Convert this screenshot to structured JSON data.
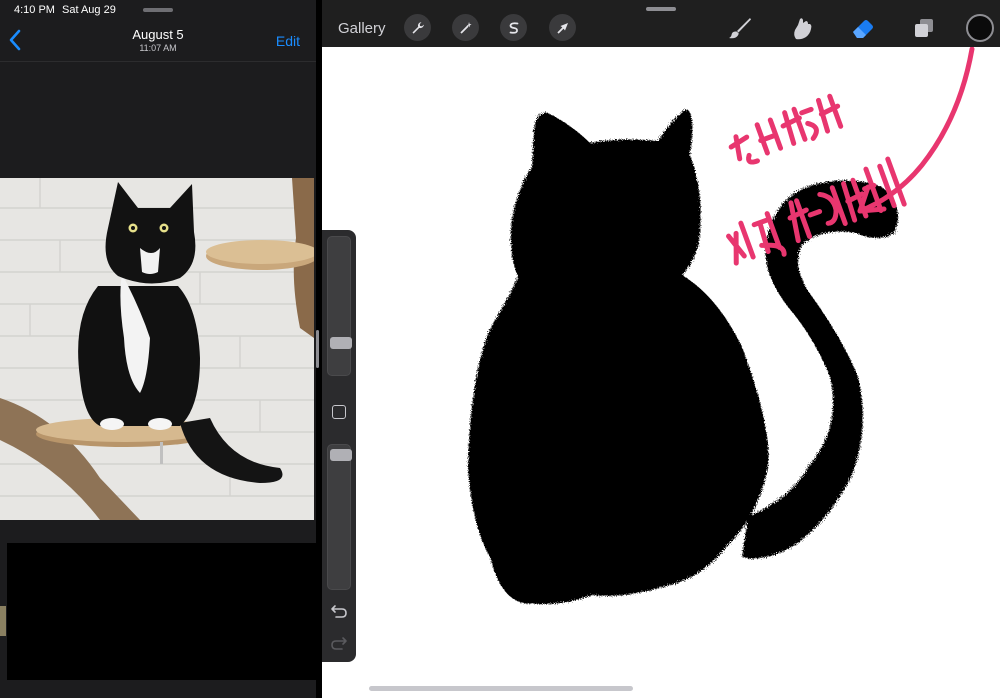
{
  "status_bar": {
    "time": "4:10 PM",
    "date": "Sat Aug 29"
  },
  "photos": {
    "nav": {
      "back_icon": "chevron-left-icon",
      "title": "August 5",
      "subtitle": "11:07 AM",
      "edit_label": "Edit"
    },
    "photo_subject": "cat-photo"
  },
  "procreate": {
    "gallery_label": "Gallery",
    "left_tools": [
      "wrench-icon",
      "magic-wand-icon",
      "selection-icon",
      "transform-arrow-icon"
    ],
    "right_tools": [
      "brush-icon",
      "smudge-icon",
      "eraser-icon",
      "layers-icon"
    ],
    "active_tool": "eraser",
    "current_color": "#0b0b0b",
    "accent_color": "#1a7cf2",
    "annotation_color": "#e8366f",
    "annotation_text": [
      "실물",
      "세상 해치운다"
    ],
    "sidebar": {
      "brush_size_level": 0.26,
      "opacity_level": 0.04,
      "modify_icon": "square-modify-icon",
      "undo_icon": "undo-arrow-icon",
      "redo_icon": "redo-arrow-icon"
    }
  }
}
